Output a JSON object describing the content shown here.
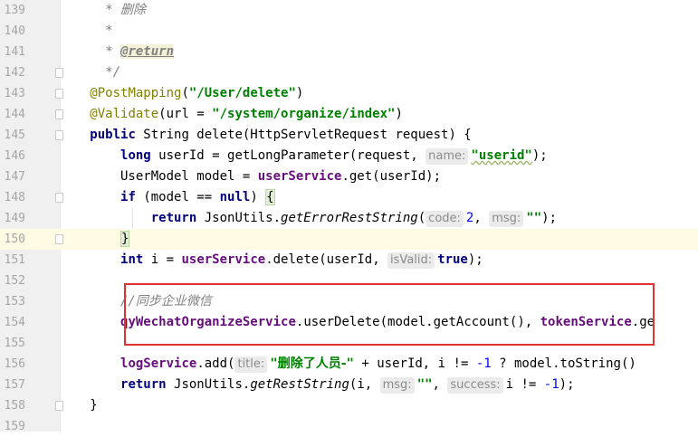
{
  "editor": {
    "lines": [
      {
        "num": "139",
        "segments": [
          {
            "cls": "cm",
            "text": "     * "
          },
          {
            "cls": "cm-cn",
            "text": "删除"
          }
        ]
      },
      {
        "num": "140",
        "segments": [
          {
            "cls": "cm",
            "text": "     *"
          }
        ]
      },
      {
        "num": "141",
        "segments": [
          {
            "cls": "cm",
            "text": "     * "
          },
          {
            "cls": "doctag",
            "text": "@return"
          }
        ]
      },
      {
        "num": "142",
        "fold": true,
        "segments": [
          {
            "cls": "cm",
            "text": "     */"
          }
        ]
      },
      {
        "num": "143",
        "fold": true,
        "segments": [
          {
            "text": "   "
          },
          {
            "cls": "ann",
            "text": "@PostMapping"
          },
          {
            "text": "("
          },
          {
            "cls": "str",
            "text": "\"/User/delete\""
          },
          {
            "text": ")"
          }
        ]
      },
      {
        "num": "144",
        "fold": true,
        "segments": [
          {
            "text": "   "
          },
          {
            "cls": "ann",
            "text": "@Validate"
          },
          {
            "text": "(url = "
          },
          {
            "cls": "str",
            "text": "\"/system/organize/index\""
          },
          {
            "text": ")"
          }
        ]
      },
      {
        "num": "145",
        "fold": true,
        "segments": [
          {
            "text": "   "
          },
          {
            "cls": "kw",
            "text": "public"
          },
          {
            "text": " String delete(HttpServletRequest request) {"
          }
        ]
      },
      {
        "num": "146",
        "segments": [
          {
            "text": "       "
          },
          {
            "cls": "kw",
            "text": "long"
          },
          {
            "text": " userId = getLongParameter(request, "
          },
          {
            "cls": "hint",
            "text": "name:"
          },
          {
            "cls": "str wavy",
            "text": "\"userid\""
          },
          {
            "text": ");"
          }
        ]
      },
      {
        "num": "147",
        "segments": [
          {
            "text": "       UserModel model = "
          },
          {
            "cls": "fld",
            "text": "userService"
          },
          {
            "text": ".get(userId);"
          }
        ]
      },
      {
        "num": "148",
        "fold": true,
        "segments": [
          {
            "text": "       "
          },
          {
            "cls": "kw",
            "text": "if"
          },
          {
            "text": " (model == "
          },
          {
            "cls": "kw",
            "text": "null"
          },
          {
            "text": ") "
          },
          {
            "cls": "brace-hl",
            "text": "{"
          }
        ]
      },
      {
        "num": "149",
        "segments": [
          {
            "text": "           "
          },
          {
            "cls": "kw",
            "text": "return"
          },
          {
            "text": " JsonUtils."
          },
          {
            "cls": "italic",
            "text": "getErrorRestString"
          },
          {
            "text": "("
          },
          {
            "cls": "hint",
            "text": "code:"
          },
          {
            "cls": "num",
            "text": "2"
          },
          {
            "text": ", "
          },
          {
            "cls": "hint",
            "text": "msg:"
          },
          {
            "cls": "str",
            "text": "\"\""
          },
          {
            "text": ");"
          }
        ]
      },
      {
        "num": "150",
        "fold": true,
        "current": true,
        "segments": [
          {
            "text": "       "
          },
          {
            "cls": "brace-hl",
            "text": "}"
          }
        ]
      },
      {
        "num": "151",
        "segments": [
          {
            "text": "       "
          },
          {
            "cls": "kw",
            "text": "int"
          },
          {
            "text": " i = "
          },
          {
            "cls": "fld",
            "text": "userService"
          },
          {
            "text": ".delete(userId, "
          },
          {
            "cls": "hint",
            "text": "isValid:"
          },
          {
            "cls": "kw",
            "text": "true"
          },
          {
            "text": ");"
          }
        ]
      },
      {
        "num": "152",
        "segments": []
      },
      {
        "num": "153",
        "segments": [
          {
            "cls": "cm",
            "text": "       //"
          },
          {
            "cls": "cm-cn",
            "text": "同步企业微信"
          }
        ]
      },
      {
        "num": "154",
        "segments": [
          {
            "text": "       "
          },
          {
            "cls": "fld",
            "text": "qyWechatOrganizeService"
          },
          {
            "text": ".userDelete(model.getAccount(), "
          },
          {
            "cls": "fld",
            "text": "tokenService"
          },
          {
            "text": ".ge"
          }
        ]
      },
      {
        "num": "155",
        "segments": []
      },
      {
        "num": "156",
        "segments": [
          {
            "text": "       "
          },
          {
            "cls": "fld",
            "text": "logService"
          },
          {
            "text": ".add("
          },
          {
            "cls": "hint",
            "text": "title:"
          },
          {
            "cls": "str",
            "text": "\""
          },
          {
            "cls": "str-cn",
            "text": "删除了人员-"
          },
          {
            "cls": "str",
            "text": "\""
          },
          {
            "text": " + userId, i != "
          },
          {
            "cls": "num",
            "text": "-1"
          },
          {
            "text": " ? model.toString()"
          }
        ]
      },
      {
        "num": "157",
        "segments": [
          {
            "text": "       "
          },
          {
            "cls": "kw",
            "text": "return"
          },
          {
            "text": " JsonUtils."
          },
          {
            "cls": "italic",
            "text": "getRestString"
          },
          {
            "text": "(i, "
          },
          {
            "cls": "hint",
            "text": "msg:"
          },
          {
            "cls": "str",
            "text": "\"\""
          },
          {
            "text": ", "
          },
          {
            "cls": "hint",
            "text": "success:"
          },
          {
            "text": "i != "
          },
          {
            "cls": "num",
            "text": "-1"
          },
          {
            "text": ");"
          }
        ]
      },
      {
        "num": "158",
        "fold": true,
        "segments": [
          {
            "text": "   }"
          }
        ]
      },
      {
        "num": "159",
        "segments": []
      }
    ]
  }
}
